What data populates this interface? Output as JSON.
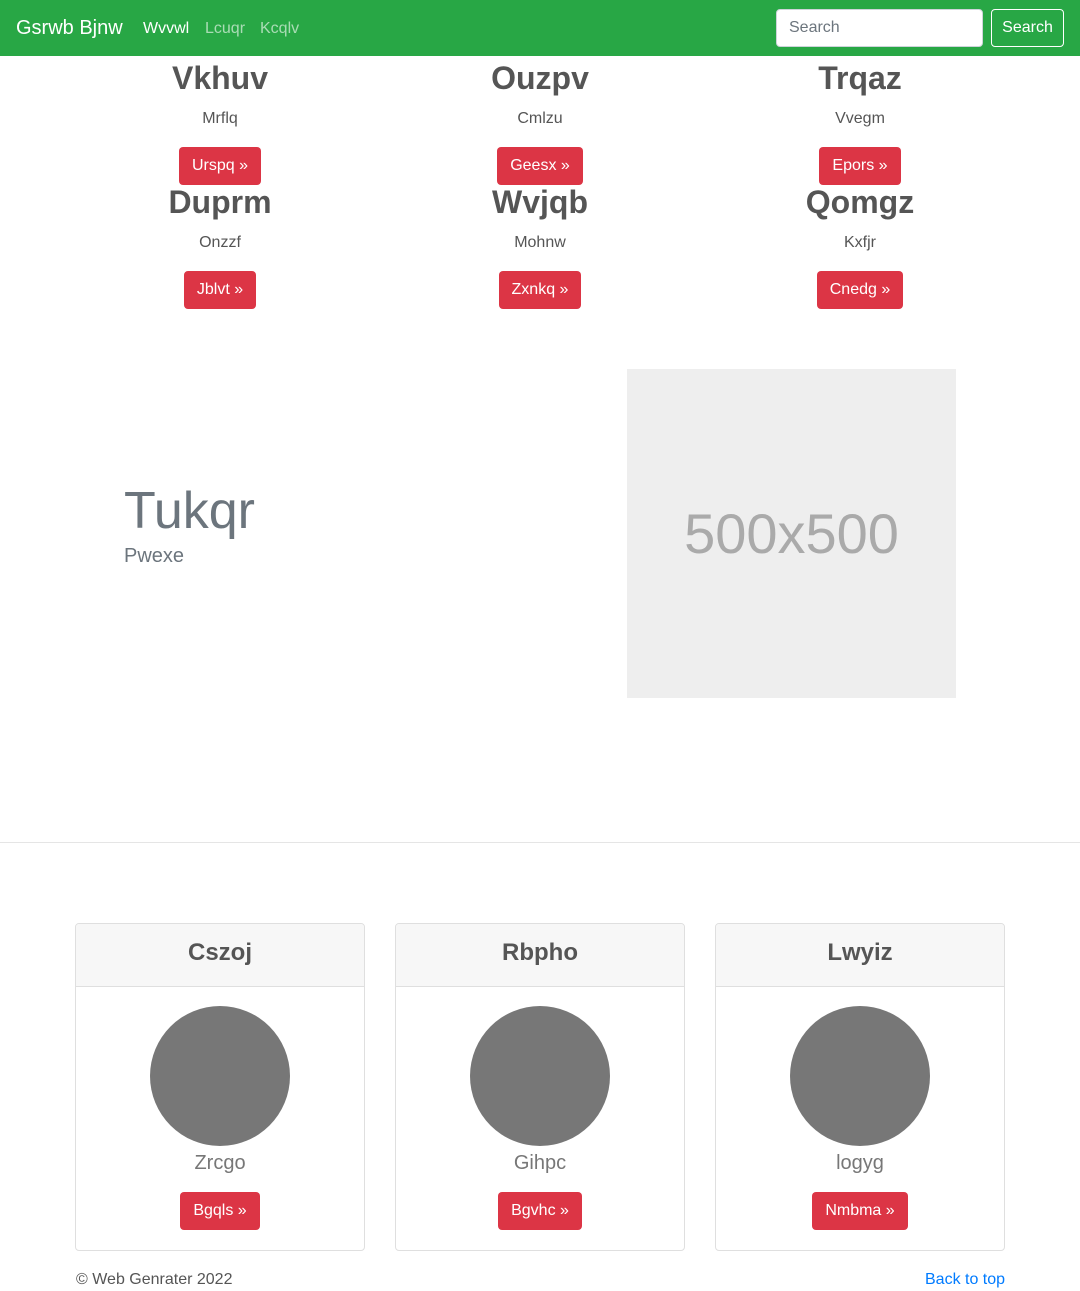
{
  "navbar": {
    "brand": "Gsrwb Bjnw",
    "links": [
      "Wvvwl",
      "Lcuqr",
      "Kcqlv"
    ],
    "search_placeholder": "Search",
    "search_button": "Search",
    "bg_color": "#28a745"
  },
  "features": [
    {
      "title": "Vkhuv",
      "text": "Mrflq",
      "button": "Urspq »"
    },
    {
      "title": "Ouzpv",
      "text": "Cmlzu",
      "button": "Geesx »"
    },
    {
      "title": "Trqaz",
      "text": "Vvegm",
      "button": "Epors »"
    },
    {
      "title": "Duprm",
      "text": "Onzzf",
      "button": "Jblvt »"
    },
    {
      "title": "Wvjqb",
      "text": "Mohnw",
      "button": "Zxnkq »"
    },
    {
      "title": "Qomgz",
      "text": "Kxfjr",
      "button": "Cnedg »"
    }
  ],
  "hero": {
    "title": "Tukqr",
    "subtitle": "Pwexe",
    "image_label": "500x500"
  },
  "cards": [
    {
      "header": "Cszoj",
      "name": "Zrcgo",
      "button": "Bgqls »"
    },
    {
      "header": "Rbpho",
      "name": "Gihpc",
      "button": "Bgvhc »"
    },
    {
      "header": "Lwyiz",
      "name": "logyg",
      "button": "Nmbma »"
    }
  ],
  "footer": {
    "copyright": "© Web Genrater 2022",
    "back_to_top": "Back to top"
  },
  "colors": {
    "accent": "#dc3545",
    "link": "#007bff"
  }
}
